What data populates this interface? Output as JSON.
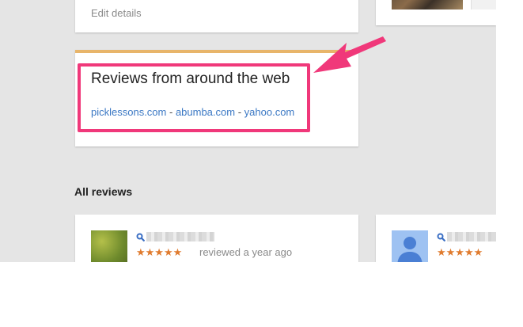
{
  "top_card": {
    "edit_label": "Edit details"
  },
  "web_reviews": {
    "title": "Reviews from around the web",
    "sources": [
      "picklessons.com",
      "abumba.com",
      "yahoo.com"
    ],
    "separator": " - "
  },
  "all_reviews": {
    "title": "All reviews",
    "reviews": [
      {
        "rating": 5,
        "stars": "★★★★★",
        "meta": "reviewed a year ago"
      },
      {
        "rating": 5,
        "stars": "★★★★★",
        "meta": ""
      }
    ]
  },
  "colors": {
    "highlight": "#f0387a",
    "accent_bar": "#e8b56a",
    "link": "#3b78c4",
    "star": "#e07b2e",
    "background": "#e5e5e5"
  },
  "icons": [
    "magnifier-icon",
    "default-avatar-icon",
    "annotation-arrow"
  ]
}
